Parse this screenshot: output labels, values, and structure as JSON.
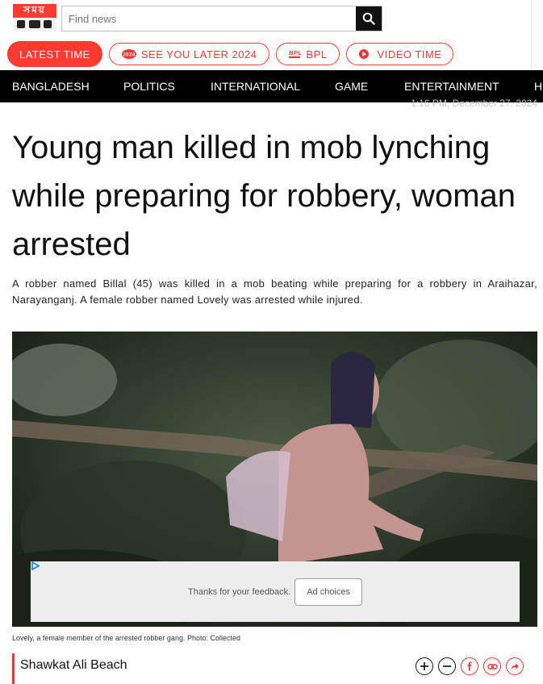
{
  "header": {
    "logo_text": "সময়",
    "search_placeholder": "Find news",
    "search_icon": "search-icon"
  },
  "quick_links": [
    {
      "label": "LATEST TIME",
      "icon": ""
    },
    {
      "label": "SEE YOU LATER 2024",
      "icon": "year-2024-badge-icon"
    },
    {
      "label": "BPL",
      "icon": "bpl-logo-icon"
    },
    {
      "label": "VIDEO TIME",
      "icon": "play-icon"
    }
  ],
  "nav": [
    "BANGLADESH",
    "POLITICS",
    "INTERNATIONAL",
    "GAME",
    "ENTERTAINMENT",
    "H"
  ],
  "article": {
    "timestamp": "1:16 PM, December 27, 2024",
    "title": "Young man killed in mob lynching while preparing for robbery, woman arrested",
    "summary": "A robber named Billal (45) was killed in a mob beating while preparing for a robbery in Araihazar, Narayanganj. A female robber named Lovely was arrested while injured.",
    "caption": "Lovely, a female member of the arrested robber gang. Photo: Collected",
    "author": "Shawkat Ali Beach"
  },
  "ad": {
    "feedback": "Thanks for your feedback.",
    "choices": "Ad choices"
  },
  "tools": [
    "zoom-in-icon",
    "zoom-out-icon",
    "facebook-icon",
    "link-icon",
    "share-icon"
  ],
  "colors": {
    "accent": "#ff3b30",
    "nav_bg": "#000000"
  }
}
